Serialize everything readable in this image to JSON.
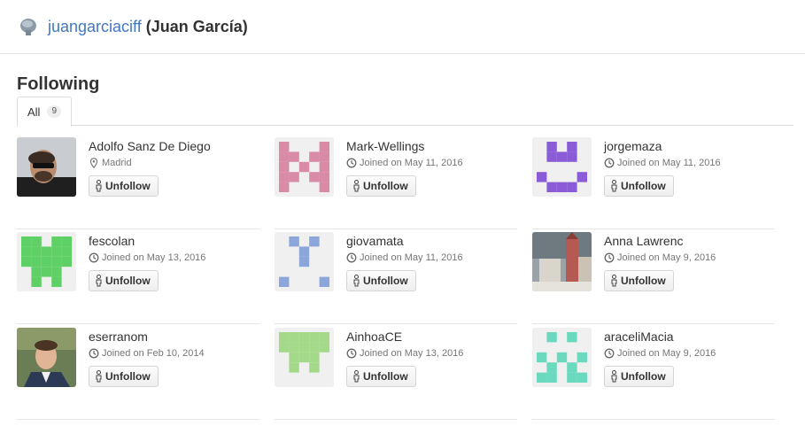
{
  "header": {
    "login": "juangarciaciff",
    "full_name": "(Juan García)"
  },
  "section_title": "Following",
  "tab": {
    "label": "All",
    "count": "9"
  },
  "unfollow_label": "Unfollow",
  "users": [
    {
      "name": "Adolfo Sanz De Diego",
      "meta": "Madrid",
      "meta_icon": "location-icon",
      "avatar": "photo-man-sunglasses"
    },
    {
      "name": "Mark-Wellings",
      "meta": "Joined on May 11, 2016",
      "meta_icon": "clock-icon",
      "avatar": "identicon",
      "color": "#d98aa6"
    },
    {
      "name": "jorgemaza",
      "meta": "Joined on May 11, 2016",
      "meta_icon": "clock-icon",
      "avatar": "identicon",
      "color": "#8a5cd7"
    },
    {
      "name": "fescolan",
      "meta": "Joined on May 13, 2016",
      "meta_icon": "clock-icon",
      "avatar": "identicon",
      "color": "#5fd065"
    },
    {
      "name": "giovamata",
      "meta": "Joined on May 11, 2016",
      "meta_icon": "clock-icon",
      "avatar": "identicon",
      "color": "#8aa6da"
    },
    {
      "name": "Anna Lawrenc",
      "meta": "Joined on May 9, 2016",
      "meta_icon": "clock-icon",
      "avatar": "photo-town-square"
    },
    {
      "name": "eserranom",
      "meta": "Joined on Feb 10, 2014",
      "meta_icon": "clock-icon",
      "avatar": "photo-man-suit"
    },
    {
      "name": "AinhoaCE",
      "meta": "Joined on May 13, 2016",
      "meta_icon": "clock-icon",
      "avatar": "identicon",
      "color": "#a4d98a"
    },
    {
      "name": "araceliMacia",
      "meta": "Joined on May 9, 2016",
      "meta_icon": "clock-icon",
      "avatar": "identicon",
      "color": "#6bd9be"
    }
  ]
}
